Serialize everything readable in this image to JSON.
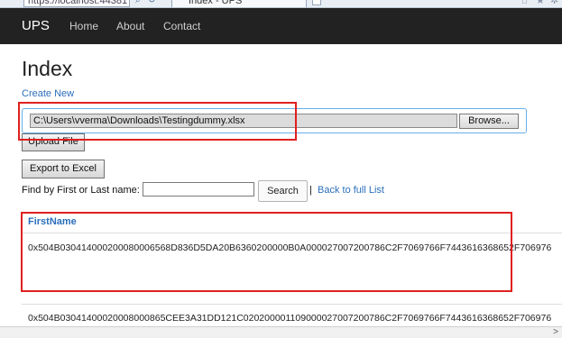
{
  "browser": {
    "address": "https://localhost:44381",
    "tab_title": "Index - UPS"
  },
  "navbar": {
    "brand": "UPS",
    "links": [
      "Home",
      "About",
      "Contact"
    ]
  },
  "page": {
    "title": "Index",
    "create_new": "Create New"
  },
  "upload": {
    "file_path": "C:\\Users\\vverma\\Downloads\\Testingdummy.xlsx",
    "browse_label": "Browse...",
    "upload_label": "Upload File"
  },
  "toolbar": {
    "export_label": "Export to Excel",
    "find_label": "Find by First or Last name:",
    "search_value": "",
    "search_label": "Search",
    "separator": "|",
    "back_link": "Back to full List"
  },
  "table": {
    "headers": [
      "FirstName"
    ],
    "rows": [
      "0x504B030414000200080006568D836D5DA20B6360200000B0A000027007200786C2F7069766F7443616368652F706976",
      "0x504B03041400020008000865CEE3A31DD121C020200001109000027007200786C2F7069766F7443616368652F706976"
    ]
  },
  "colors": {
    "navbar_bg": "#222222",
    "link": "#2a6ebb",
    "annotation": "#e02020"
  }
}
